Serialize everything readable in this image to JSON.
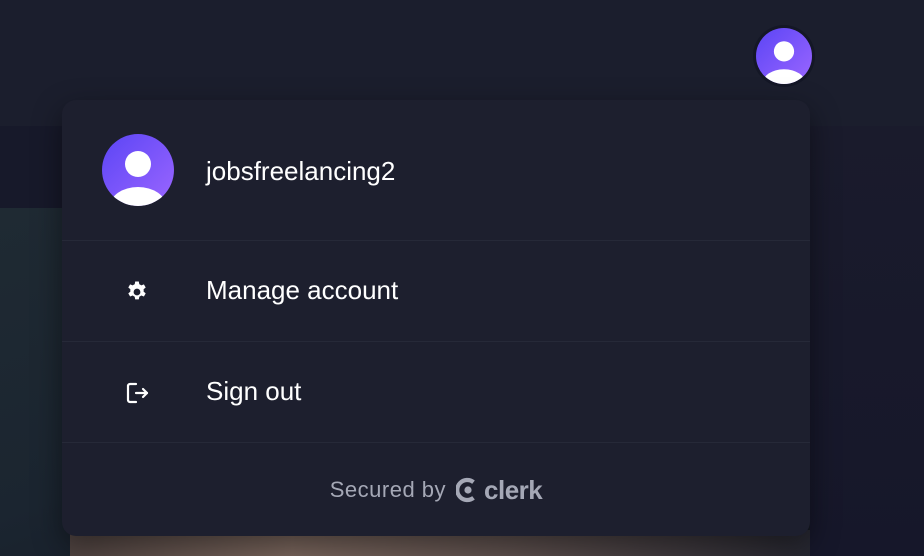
{
  "header": {
    "avatar_icon": "user-avatar-icon"
  },
  "user_menu": {
    "username": "jobsfreelancing2",
    "items": [
      {
        "label": "Manage account",
        "icon": "gear-icon"
      },
      {
        "label": "Sign out",
        "icon": "sign-out-icon"
      }
    ],
    "footer": {
      "secured_by": "Secured by",
      "brand": "clerk"
    }
  },
  "colors": {
    "avatar_gradient_start": "#6c47ff",
    "avatar_gradient_end": "#9b6bff",
    "menu_background": "#1d1f2e",
    "text_primary": "#ffffff",
    "text_muted": "#a5a8b6"
  }
}
